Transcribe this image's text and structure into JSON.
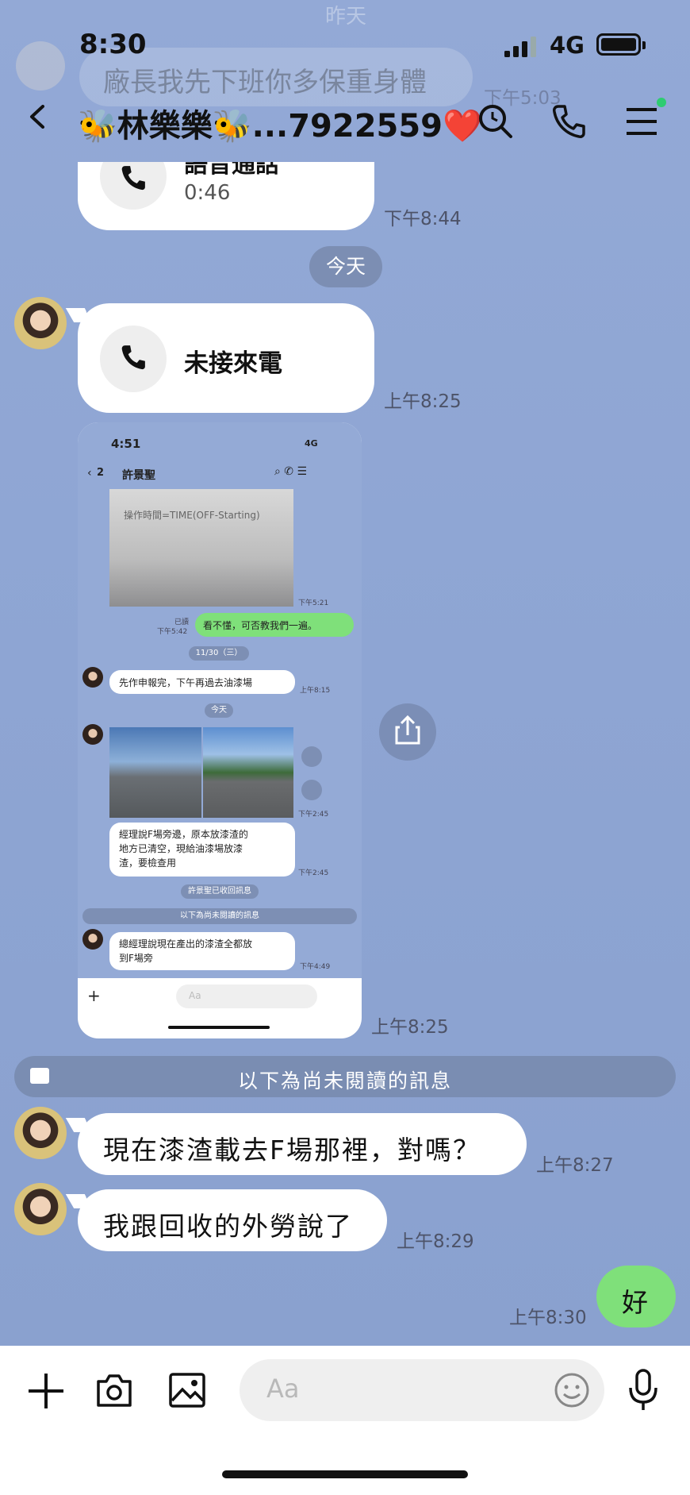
{
  "status": {
    "time": "8:30",
    "network": "4G"
  },
  "header": {
    "title": "🐝林樂樂🐝...7922559❤️"
  },
  "background": {
    "top_text": "昨天",
    "faded_message": "廠長我先下班你多保重身體",
    "faded_time": "下午5:03"
  },
  "messages": {
    "voice_call": {
      "label": "語音通話",
      "duration": "0:46",
      "time": "下午8:44"
    },
    "date_today": "今天",
    "missed_call": {
      "label": "未接來電",
      "time": "上午8:25"
    },
    "screenshot_time": "上午8:25",
    "unread_divider": "以下為尚未閱讀的訊息",
    "msg1": {
      "text": "現在漆渣載去F場那裡，對嗎？",
      "time": "上午8:27"
    },
    "msg2": {
      "text": "我跟回收的外勞說了",
      "time": "上午8:29"
    },
    "reply": {
      "text": "好",
      "time": "上午8:30"
    }
  },
  "embedded_screenshot": {
    "time": "4:51",
    "network": "4G",
    "back_count": "2",
    "contact": "許景聖",
    "image_text": "操作時間=TIME(OFF-Starting)",
    "image_time": "下午5:21",
    "read_label": "已讀",
    "read_time": "下午5:42",
    "sent_msg": "看不懂，可否教我們一遍。",
    "date1": "11/30（三）",
    "msg_a": "先作申報完，下午再過去油漆場",
    "msg_a_time": "上午8:15",
    "date2": "今天",
    "photos_time": "下午2:45",
    "msg_b_l1": "經理說F場旁邊，原本放漆渣的",
    "msg_b_l2": "地方已清空，現給油漆場放漆",
    "msg_b_l3": "渣，要檢查用",
    "msg_b_time": "下午2:45",
    "recall_notice": "許景聖已收回訊息",
    "unread": "以下為尚未閱讀的訊息",
    "msg_c_l1": "總經理說現在產出的漆渣全都放",
    "msg_c_l2": "到F場旁",
    "msg_c_time": "下午4:49",
    "input_placeholder": "Aa"
  },
  "input": {
    "placeholder": "Aa"
  },
  "colors": {
    "chat_bg": "#8fa6d3",
    "sent_bubble": "#7fe07a",
    "date_pill": "#7c8eb3"
  },
  "icons": [
    "back-icon",
    "search-icon",
    "phone-icon",
    "menu-icon",
    "plus-icon",
    "camera-icon",
    "image-icon",
    "emoji-icon",
    "mic-icon",
    "share-icon"
  ]
}
